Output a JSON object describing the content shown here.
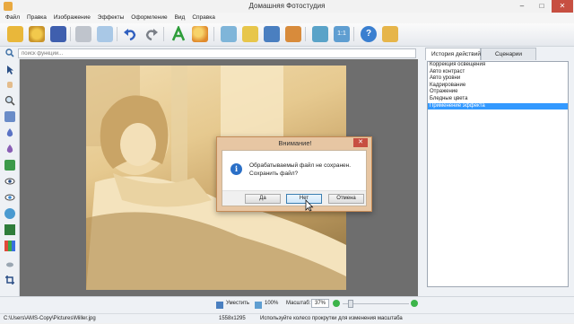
{
  "window": {
    "title": "Домашняя Фотостудия",
    "minimize": "–",
    "maximize": "□",
    "close": "✕"
  },
  "menu": [
    "Файл",
    "Правка",
    "Изображение",
    "Эффекты",
    "Оформление",
    "Вид",
    "Справка"
  ],
  "search": {
    "placeholder": "поиск функций..."
  },
  "tabs": [
    {
      "label": "История действий",
      "active": true
    },
    {
      "label": "Сценарии",
      "active": false
    }
  ],
  "history": {
    "items": [
      "Коррекция освещения",
      "Авто контраст",
      "Авто уровни",
      "Кадрирование",
      "Отражение",
      "Бледные цвета",
      "Применение эффекта"
    ],
    "selected_index": 6
  },
  "dialog": {
    "title": "Внимание!",
    "message_line1": "Обрабатываемый файл не сохранен.",
    "message_line2": "Сохранить файл?",
    "icon": "i",
    "buttons": {
      "yes": "Да",
      "no": "Нет",
      "cancel": "Отмена"
    },
    "close": "✕"
  },
  "statusbar": {
    "fit_label": "Уместить",
    "percent_label": "100%",
    "zoom_label": "Масштаб:",
    "zoom_value": "37%",
    "path": "C:\\Users\\AMS-Copy\\Pictures\\Miller.jpg",
    "dimensions": "1558x1295",
    "hint": "Используйте колесо прокрутки для изменения масштаба"
  },
  "colors": {
    "accent_selection": "#3399ff",
    "dialog_frame": "#e7c6a3",
    "close_red": "#c74f41",
    "sepia_photo": "#d9b97f"
  }
}
